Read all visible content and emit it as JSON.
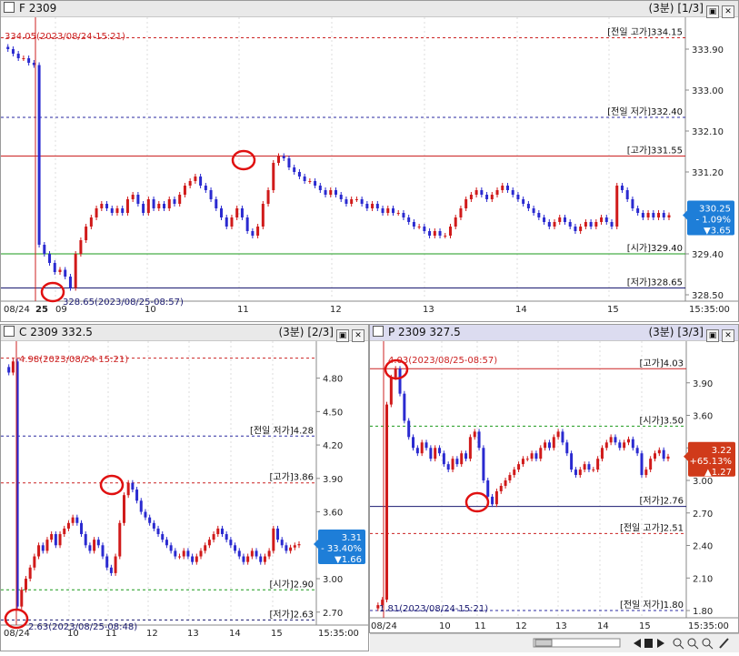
{
  "top": {
    "title": "F 2309",
    "period": "(3분)",
    "page": "[1/3]",
    "chart_data": {
      "type": "candlestick",
      "ylim": [
        328.4,
        334.4
      ],
      "y_ticks": [
        "333.90",
        "333.00",
        "332.10",
        "331.20",
        "330.30",
        "329.40",
        "328.50"
      ],
      "x_ticks": [
        "08/24",
        "25",
        "09",
        "10",
        "11",
        "12",
        "13",
        "14",
        "15",
        "15:35:00"
      ],
      "ohlc": [
        333.95,
        333.9,
        333.8,
        333.7,
        333.7,
        333.6,
        333.55,
        329.6,
        329.4,
        329.2,
        329.0,
        329.05,
        328.9,
        328.65,
        329.4,
        329.7,
        330.0,
        330.2,
        330.4,
        330.5,
        330.4,
        330.3,
        330.4,
        330.3,
        330.6,
        330.7,
        330.5,
        330.3,
        330.6,
        330.4,
        330.5,
        330.4,
        330.6,
        330.5,
        330.7,
        330.9,
        331.0,
        331.1,
        330.9,
        330.8,
        330.6,
        330.4,
        330.2,
        330.0,
        330.2,
        330.4,
        330.2,
        329.9,
        329.8,
        330.0,
        330.5,
        330.8,
        331.4,
        331.55,
        331.5,
        331.3,
        331.2,
        331.1,
        331.0,
        331.0,
        330.9,
        330.8,
        330.7,
        330.8,
        330.7,
        330.6,
        330.5,
        330.6,
        330.6,
        330.5,
        330.4,
        330.5,
        330.4,
        330.3,
        330.4,
        330.3,
        330.3,
        330.2,
        330.1,
        330.0,
        330.0,
        329.9,
        329.8,
        329.9,
        329.8,
        329.8,
        330.0,
        330.2,
        330.4,
        330.6,
        330.7,
        330.8,
        330.7,
        330.6,
        330.7,
        330.8,
        330.9,
        330.8,
        330.7,
        330.6,
        330.5,
        330.4,
        330.3,
        330.2,
        330.1,
        330.0,
        330.1,
        330.2,
        330.1,
        330.0,
        329.9,
        330.0,
        330.1,
        330.0,
        330.1,
        330.2,
        330.1,
        330.0,
        330.9,
        330.8,
        330.6,
        330.4,
        330.3,
        330.2,
        330.3,
        330.2,
        330.3,
        330.2,
        330.25
      ],
      "ref_lines": [
        {
          "label": "[전일 고가]334.15",
          "value": 334.15,
          "color": "#cc2222",
          "style": "dash"
        },
        {
          "label": "[전일 저가]332.40",
          "value": 332.4,
          "color": "#2a2aa0",
          "style": "dash"
        },
        {
          "label": "[고가]331.55",
          "value": 331.55,
          "color": "#cc2222",
          "style": "solid"
        },
        {
          "label": "[시가]329.40",
          "value": 329.4,
          "color": "#1a9a1a",
          "style": "solid"
        },
        {
          "label": "[저가]328.65",
          "value": 328.65,
          "color": "#1a1a70",
          "style": "solid"
        }
      ],
      "annotations": [
        "334.05(2023/08/24-15:21)",
        "328.65(2023/08/25-08:57)"
      ],
      "current": {
        "price": "330.25",
        "pct": "- 1.09%",
        "chg": "▼3.65",
        "color": "#1e7ed8"
      }
    }
  },
  "call": {
    "title": "C 2309 332.5",
    "period": "(3분)",
    "page": "[2/3]",
    "chart_data": {
      "type": "candlestick",
      "ylim": [
        2.6,
        5.05
      ],
      "y_ticks": [
        "4.80",
        "4.50",
        "4.20",
        "3.90",
        "3.60",
        "3.30",
        "3.00",
        "2.70"
      ],
      "x_ticks": [
        "08/24",
        "10",
        "11",
        "12",
        "13",
        "14",
        "15",
        "15:35:00"
      ],
      "ohlc": [
        4.9,
        4.85,
        4.95,
        2.75,
        2.9,
        3.0,
        3.1,
        3.2,
        3.3,
        3.25,
        3.35,
        3.4,
        3.3,
        3.4,
        3.45,
        3.5,
        3.55,
        3.5,
        3.4,
        3.3,
        3.25,
        3.35,
        3.3,
        3.2,
        3.1,
        3.05,
        3.2,
        3.5,
        3.75,
        3.86,
        3.8,
        3.7,
        3.6,
        3.55,
        3.5,
        3.45,
        3.4,
        3.35,
        3.3,
        3.25,
        3.2,
        3.2,
        3.25,
        3.2,
        3.15,
        3.2,
        3.25,
        3.3,
        3.35,
        3.4,
        3.45,
        3.4,
        3.35,
        3.3,
        3.25,
        3.2,
        3.15,
        3.2,
        3.25,
        3.2,
        3.15,
        3.2,
        3.25,
        3.45,
        3.35,
        3.3,
        3.25,
        3.28,
        3.3,
        3.31
      ],
      "ref_lines": [
        {
          "label": "",
          "value": 4.98,
          "color": "#cc2222",
          "style": "dash"
        },
        {
          "label": "[전일 저가]4.28",
          "value": 4.28,
          "color": "#2a2aa0",
          "style": "dash"
        },
        {
          "label": "[고가]3.86",
          "value": 3.86,
          "color": "#cc2222",
          "style": "dash"
        },
        {
          "label": "[시가]2.90",
          "value": 2.9,
          "color": "#1a9a1a",
          "style": "dash"
        },
        {
          "label": "[저가]2.63",
          "value": 2.63,
          "color": "#1a1a70",
          "style": "dash"
        }
      ],
      "annotations": [
        "4.98(2023/08/24-15:21)",
        "2.63(2023/08/25-08:48)"
      ],
      "current": {
        "price": "3.31",
        "pct": "- 33.40%",
        "chg": "▼1.66",
        "color": "#1e7ed8"
      }
    }
  },
  "put": {
    "title": "P 2309 327.5",
    "period": "(3분)",
    "page": "[3/3]",
    "chart_data": {
      "type": "candlestick",
      "ylim": [
        1.75,
        4.2
      ],
      "y_ticks": [
        "3.90",
        "3.60",
        "3.30",
        "3.00",
        "2.70",
        "2.40",
        "2.10",
        "1.80"
      ],
      "x_ticks": [
        "08/24",
        "10",
        "11",
        "12",
        "13",
        "14",
        "15",
        "15:35:00"
      ],
      "ohlc": [
        1.82,
        1.85,
        1.9,
        3.7,
        3.95,
        4.03,
        3.8,
        3.55,
        3.4,
        3.3,
        3.25,
        3.35,
        3.3,
        3.2,
        3.3,
        3.25,
        3.15,
        3.1,
        3.2,
        3.15,
        3.25,
        3.2,
        3.4,
        3.45,
        3.3,
        3.0,
        2.85,
        2.78,
        2.9,
        2.95,
        3.0,
        3.05,
        3.1,
        3.15,
        3.2,
        3.2,
        3.25,
        3.2,
        3.3,
        3.35,
        3.3,
        3.4,
        3.45,
        3.35,
        3.25,
        3.1,
        3.05,
        3.1,
        3.15,
        3.1,
        3.1,
        3.2,
        3.3,
        3.35,
        3.4,
        3.35,
        3.3,
        3.35,
        3.38,
        3.3,
        3.25,
        3.05,
        3.1,
        3.2,
        3.25,
        3.28,
        3.2,
        3.22
      ],
      "ref_lines": [
        {
          "label": "[고가]4.03",
          "value": 4.03,
          "color": "#cc2222",
          "style": "solid"
        },
        {
          "label": "[시가]3.50",
          "value": 3.5,
          "color": "#1a9a1a",
          "style": "dash"
        },
        {
          "label": "[저가]2.76",
          "value": 2.76,
          "color": "#1a1a70",
          "style": "solid"
        },
        {
          "label": "[전일 고가]2.51",
          "value": 2.51,
          "color": "#cc2222",
          "style": "dash"
        },
        {
          "label": "[전일 저가]1.80",
          "value": 1.8,
          "color": "#2a2aa0",
          "style": "dash"
        }
      ],
      "annotations": [
        "4.03(2023/08/25-08:57)",
        "1.81(2023/08/24-15:21)"
      ],
      "current": {
        "price": "3.22",
        "pct": "+65.13%",
        "chg": "▲1.27",
        "color": "#d03a1a"
      }
    }
  },
  "icons": [
    "checkbox-icon",
    "restore-icon",
    "close-icon",
    "zoom-in-icon",
    "zoom-out-icon",
    "search-icon",
    "tool-icon",
    "scroll-left-icon",
    "scroll-right-icon",
    "stop-icon"
  ]
}
